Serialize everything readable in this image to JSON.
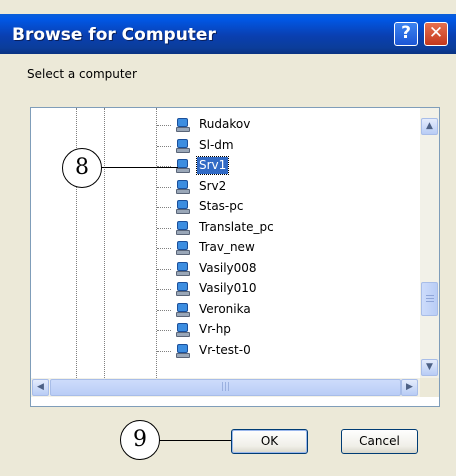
{
  "window": {
    "title": "Browse for Computer",
    "help_glyph": "?",
    "close_glyph": "✕"
  },
  "dialog": {
    "prompt": "Select a computer",
    "items": [
      {
        "label": "Rudakov",
        "icon": "computer-icon",
        "selected": false
      },
      {
        "label": "Sl-dm",
        "icon": "computer-icon",
        "selected": false
      },
      {
        "label": "Srv1",
        "icon": "computer-icon",
        "selected": true
      },
      {
        "label": "Srv2",
        "icon": "computer-icon",
        "selected": false
      },
      {
        "label": "Stas-pc",
        "icon": "computer-icon",
        "selected": false
      },
      {
        "label": "Translate_pc",
        "icon": "computer-icon",
        "selected": false
      },
      {
        "label": "Trav_new",
        "icon": "computer-icon",
        "selected": false
      },
      {
        "label": "Vasily008",
        "icon": "computer-icon",
        "selected": false
      },
      {
        "label": "Vasily010",
        "icon": "computer-icon",
        "selected": false
      },
      {
        "label": "Veronika",
        "icon": "computer-icon",
        "selected": false
      },
      {
        "label": "Vr-hp",
        "icon": "computer-icon",
        "selected": false
      },
      {
        "label": "Vr-test-0",
        "icon": "computer-icon",
        "selected": false
      }
    ],
    "ok_label": "OK",
    "cancel_label": "Cancel"
  },
  "callouts": {
    "step8": "8",
    "step9": "9"
  },
  "colors": {
    "title_bar": "#0a3fb0",
    "selection": "#316ac5",
    "dialog_bg": "#ece9d8"
  }
}
